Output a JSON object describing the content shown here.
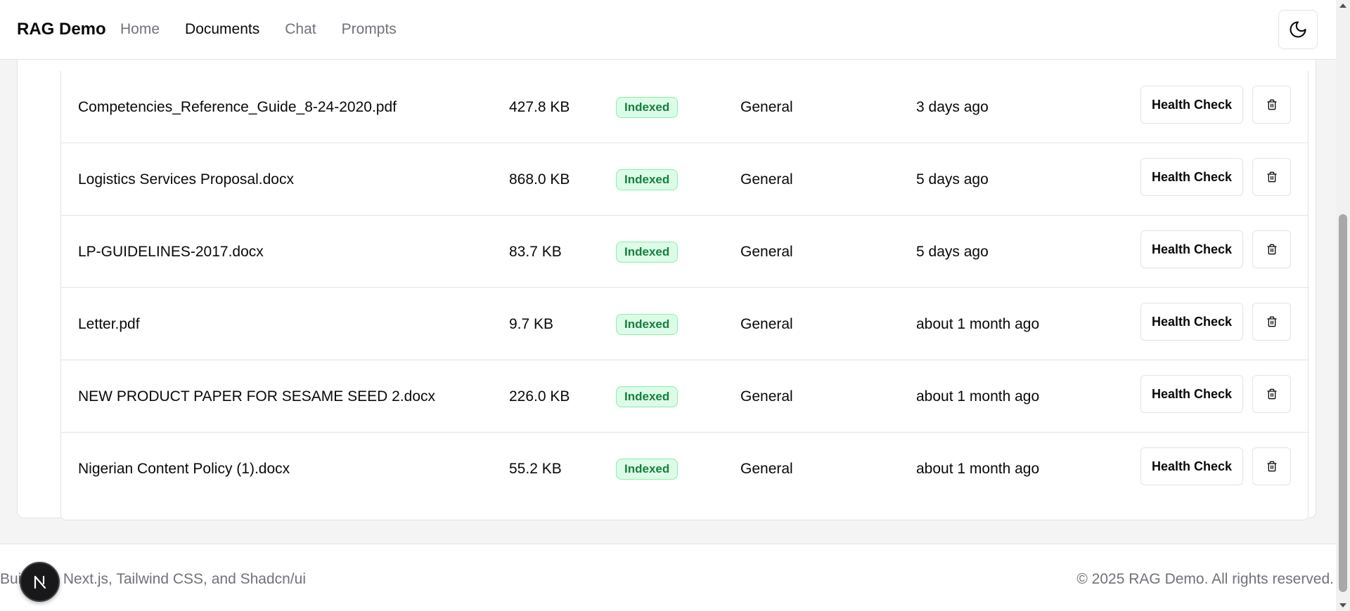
{
  "header": {
    "brand": "RAG Demo",
    "nav": [
      {
        "label": "Home",
        "active": false
      },
      {
        "label": "Documents",
        "active": true
      },
      {
        "label": "Chat",
        "active": false
      },
      {
        "label": "Prompts",
        "active": false
      }
    ],
    "theme_toggle_icon": "moon-icon"
  },
  "documents": [
    {
      "name": "Competencies_Reference_Guide_8-24-2020.pdf",
      "size": "427.8 KB",
      "status": "Indexed",
      "category": "General",
      "uploaded": "3 days ago"
    },
    {
      "name": "Logistics Services Proposal.docx",
      "size": "868.0 KB",
      "status": "Indexed",
      "category": "General",
      "uploaded": "5 days ago"
    },
    {
      "name": "LP-GUIDELINES-2017.docx",
      "size": "83.7 KB",
      "status": "Indexed",
      "category": "General",
      "uploaded": "5 days ago"
    },
    {
      "name": "Letter.pdf",
      "size": "9.7 KB",
      "status": "Indexed",
      "category": "General",
      "uploaded": "about 1 month ago"
    },
    {
      "name": "NEW PRODUCT PAPER FOR SESAME SEED 2.docx",
      "size": "226.0 KB",
      "status": "Indexed",
      "category": "General",
      "uploaded": "about 1 month ago"
    },
    {
      "name": "Nigerian Content Policy (1).docx",
      "size": "55.2 KB",
      "status": "Indexed",
      "category": "General",
      "uploaded": "about 1 month ago"
    }
  ],
  "actions": {
    "health_check_label": "Health Check",
    "delete_icon": "trash-icon"
  },
  "footer": {
    "left": "Built with Next.js, Tailwind CSS, and Shadcn/ui",
    "right": "© 2025 RAG Demo. All rights reserved."
  },
  "colors": {
    "badge_text": "#15803d",
    "badge_bg": "#dcfce7",
    "badge_border": "#86efac",
    "muted": "#71717a"
  }
}
